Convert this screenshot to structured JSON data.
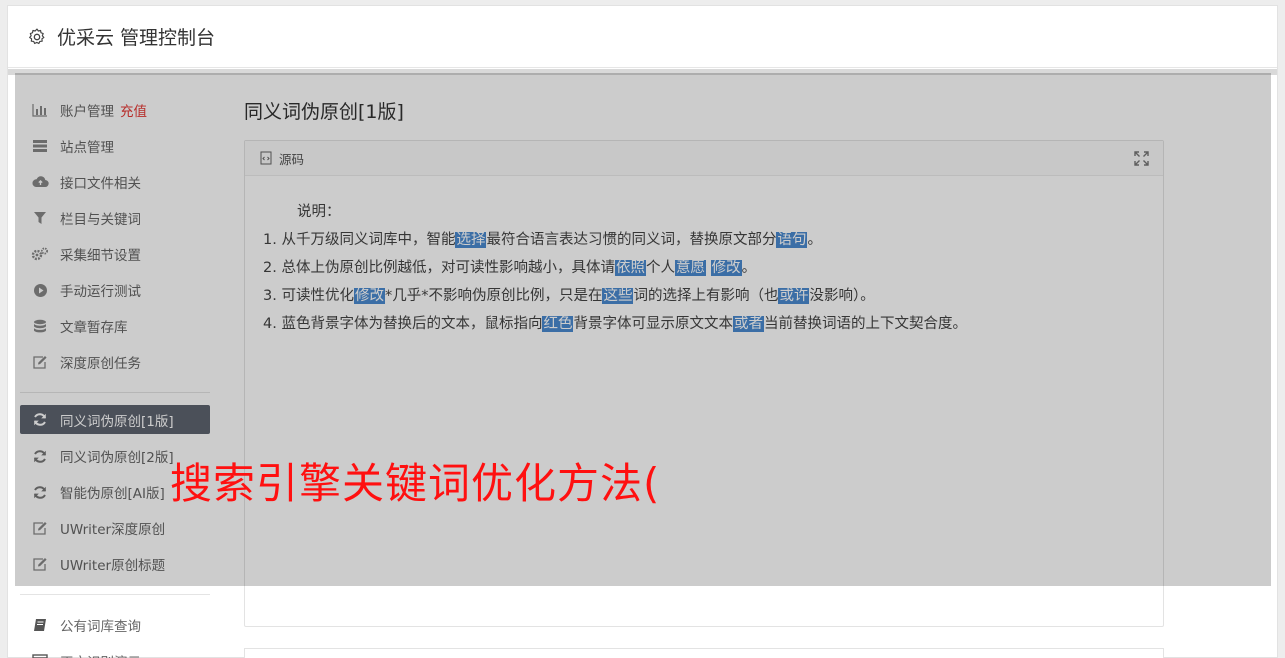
{
  "header": {
    "title": "优采云 管理控制台"
  },
  "sidebar": {
    "group1": [
      {
        "label": "账户管理",
        "badge": "充值",
        "icon": "bar-chart-icon"
      },
      {
        "label": "站点管理",
        "icon": "server-icon"
      },
      {
        "label": "接口文件相关",
        "icon": "cloud-upload-icon"
      },
      {
        "label": "栏目与关键词",
        "icon": "filter-icon"
      },
      {
        "label": "采集细节设置",
        "icon": "cogs-icon"
      },
      {
        "label": "手动运行测试",
        "icon": "play-circle-icon"
      },
      {
        "label": "文章暂存库",
        "icon": "database-icon"
      },
      {
        "label": "深度原创任务",
        "icon": "edit-icon"
      }
    ],
    "group2": [
      {
        "label": "同义词伪原创[1版]",
        "icon": "refresh-icon",
        "active": true
      },
      {
        "label": "同义词伪原创[2版]",
        "icon": "refresh-icon"
      },
      {
        "label": "智能伪原创[AI版]",
        "icon": "refresh-icon"
      },
      {
        "label": "UWriter深度原创",
        "icon": "edit-icon"
      },
      {
        "label": "UWriter原创标题",
        "icon": "edit-icon"
      }
    ],
    "group3": [
      {
        "label": "公有词库查询",
        "icon": "book-icon"
      },
      {
        "label": "正文识别演示",
        "icon": "window-icon"
      }
    ]
  },
  "main": {
    "title": "同义词伪原创[1版]",
    "panel_label": "源码",
    "intro": "说明：",
    "lines": [
      [
        {
          "t": "1. 从千万级同义词库中，智能"
        },
        {
          "t": "选择",
          "h": true
        },
        {
          "t": "最符合语言表达习惯的同义词，替换原文部分"
        },
        {
          "t": "语句",
          "h": true
        },
        {
          "t": "。"
        }
      ],
      [
        {
          "t": "2. 总体上伪原创比例越低，对可读性影响越小，具体请"
        },
        {
          "t": "依照",
          "h": true
        },
        {
          "t": "个人"
        },
        {
          "t": "意愿",
          "h": true
        },
        {
          "t": " "
        },
        {
          "t": "修改",
          "h": true
        },
        {
          "t": "。"
        }
      ],
      [
        {
          "t": "3. 可读性优化"
        },
        {
          "t": "修改",
          "h": true
        },
        {
          "t": "*几乎*不影响伪原创比例，只是在"
        },
        {
          "t": "这些",
          "h": true
        },
        {
          "t": "词的选择上有影响（也"
        },
        {
          "t": "或许",
          "h": true
        },
        {
          "t": "没影响）。"
        }
      ],
      [
        {
          "t": "4. 蓝色背景字体为替换后的文本，鼠标指向"
        },
        {
          "t": "红色",
          "h": true
        },
        {
          "t": "背景字体可显示原文文本"
        },
        {
          "t": "或者",
          "h": true
        },
        {
          "t": "当前替换词语的上下文契合度。"
        }
      ]
    ]
  },
  "overlay_text": "搜索引擎关键词优化方法(",
  "colors": {
    "active_bg": "#5e6470",
    "highlight": "#4a8ad0",
    "recharge": "#e53935",
    "overlay_text": "#ff1010"
  }
}
